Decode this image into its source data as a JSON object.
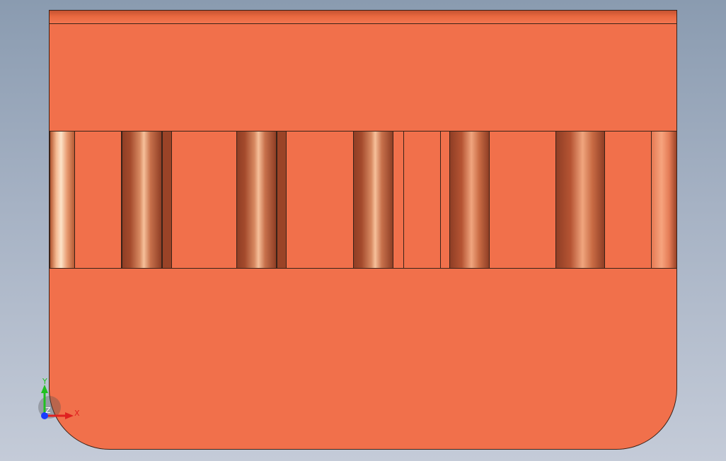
{
  "viewport": {
    "background_top": "#8a9bb0",
    "background_bottom": "#c4cbd8"
  },
  "part": {
    "face_color": "#f1704b",
    "edge_color": "#3a2218",
    "slot_count": 7
  },
  "triad": {
    "x_label": "X",
    "y_label": "Y",
    "z_label": "Z",
    "x_color": "#e02020",
    "y_color": "#20c020",
    "z_color": "#1a3cff"
  }
}
